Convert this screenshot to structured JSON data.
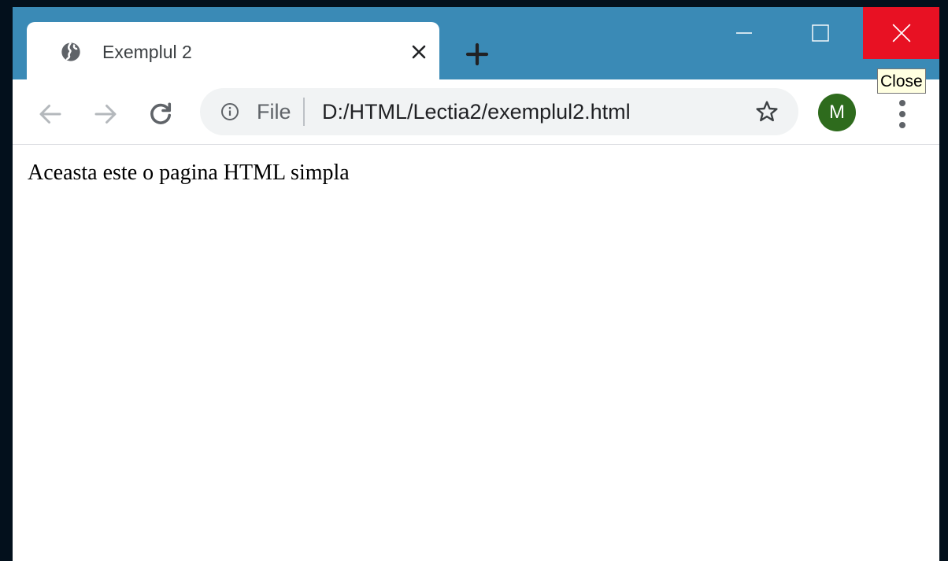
{
  "window": {
    "tab_title": "Exemplul 2",
    "tab_icon": "globe-icon",
    "tooltip": "Close"
  },
  "toolbar": {
    "omnibox": {
      "scheme_label": "File",
      "url": "D:/HTML/Lectia2/exemplul2.html"
    },
    "profile_initial": "M"
  },
  "page": {
    "body_text": "Aceasta este o pagina HTML simpla"
  },
  "colors": {
    "titlebar": "#3a8ab6",
    "close_button": "#e81123",
    "avatar": "#2e6b1d",
    "omnibox": "#f1f3f4"
  }
}
